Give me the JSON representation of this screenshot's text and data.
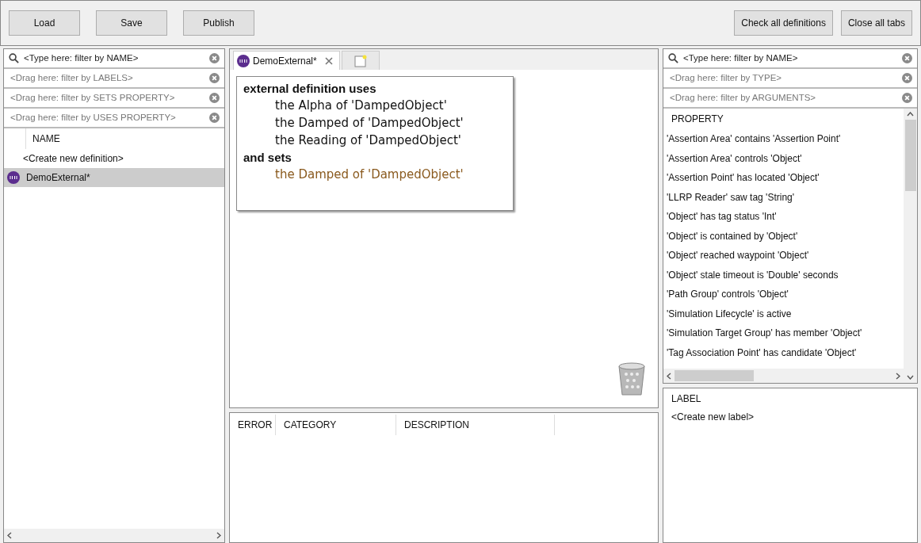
{
  "toolbar": {
    "left_buttons": [
      "Load",
      "Save",
      "Publish"
    ],
    "right_buttons": [
      "Check all definitions",
      "Close all tabs"
    ]
  },
  "definitions_panel": {
    "filters": [
      {
        "kind": "search",
        "placeholder": "<Type here: filter by NAME>"
      },
      {
        "kind": "drag",
        "placeholder": "<Drag here: filter by LABELS>"
      },
      {
        "kind": "drag",
        "placeholder": "<Drag here: filter by SETS PROPERTY>"
      },
      {
        "kind": "drag",
        "placeholder": "<Drag here: filter by USES PROPERTY>"
      }
    ],
    "column": "NAME",
    "create_item": "<Create new definition>",
    "items": [
      {
        "name": "DemoExternal*",
        "selected": true
      }
    ]
  },
  "editor": {
    "tabs": [
      {
        "kind": "definition",
        "label": "DemoExternal*",
        "selected": true
      },
      {
        "kind": "new",
        "selected": false
      }
    ],
    "definition_lines": [
      {
        "kind": "heading",
        "text": "external definition uses"
      },
      {
        "kind": "uses",
        "text": "the Alpha of 'DampedObject'"
      },
      {
        "kind": "uses",
        "text": "the Damped of 'DampedObject'"
      },
      {
        "kind": "uses",
        "text": "the Reading of 'DampedObject'"
      },
      {
        "kind": "heading",
        "text": "and sets"
      },
      {
        "kind": "sets",
        "text": "the Damped of 'DampedObject'"
      }
    ]
  },
  "errors_table": {
    "columns": [
      "ERROR",
      "CATEGORY",
      "DESCRIPTION"
    ]
  },
  "properties_panel": {
    "filters": [
      {
        "kind": "search",
        "placeholder": "<Type here: filter by NAME>"
      },
      {
        "kind": "drag",
        "placeholder": "<Drag here: filter by TYPE>"
      },
      {
        "kind": "drag",
        "placeholder": "<Drag here: filter by ARGUMENTS>"
      }
    ],
    "column": "PROPERTY",
    "items": [
      "'Assertion Area' contains 'Assertion Point'",
      "'Assertion Area' controls 'Object'",
      "'Assertion Point' has located 'Object'",
      "'LLRP Reader' saw tag 'String'",
      "'Object' has tag status 'Int'",
      "'Object' is contained by 'Object'",
      "'Object' reached waypoint 'Object'",
      "'Object' stale timeout is 'Double' seconds",
      "'Path Group' controls 'Object'",
      "'Simulation Lifecycle' is active",
      "'Simulation Target Group' has member 'Object'",
      "'Tag Association Point' has candidate 'Object'"
    ]
  },
  "labels_panel": {
    "column": "LABEL",
    "create_item": "<Create new label>"
  }
}
